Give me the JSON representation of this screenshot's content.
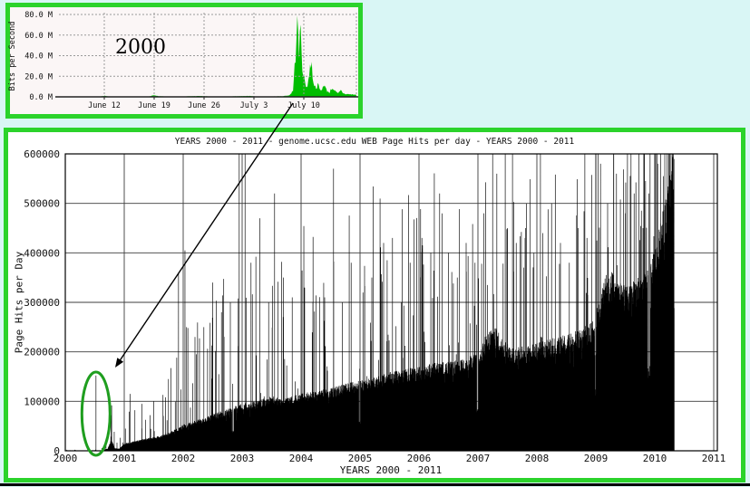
{
  "page": {
    "bg_color": "#d9f6f5",
    "accent_border_color": "#2bd32b",
    "bottom_rule_color": "#000000"
  },
  "annotations": {
    "arrow": "black arrow drawn from the inset 2000 bandwidth chart down to the circled first-traffic spike on the main chart",
    "ellipse_note": "green ellipse circling the isolated mid-2000 spike"
  },
  "chart_data": [
    {
      "id": "inset-bandwidth-week-2000",
      "type": "area",
      "annotation": "2000",
      "ylabel": "Bits per Second",
      "ylim": [
        0,
        80000000
      ],
      "yticks": [
        {
          "label": "80.0 M",
          "value": 80
        },
        {
          "label": "60.0 M",
          "value": 60
        },
        {
          "label": "40.0 M",
          "value": 40
        },
        {
          "label": "20.0 M",
          "value": 20
        },
        {
          "label": "0.0 M",
          "value": 0
        }
      ],
      "xticks": [
        "June 12",
        "June 19",
        "June 26",
        "July 3",
        "July 10"
      ],
      "legend_position": "none",
      "grid": true,
      "series": [
        {
          "name": "bits-per-second",
          "color": "#00bd00",
          "unit": "Mbit/s",
          "peak_mbps": 77,
          "secondary_peak_mbps": 65,
          "envelope_points_day_mbps": [
            [
              -2.4,
              0.15
            ],
            [
              2,
              0.2
            ],
            [
              3.4,
              0.25
            ],
            [
              4,
              1.1
            ],
            [
              4.6,
              0.3
            ],
            [
              8,
              0.2
            ],
            [
              10.4,
              0.4
            ],
            [
              11,
              1.7
            ],
            [
              11.6,
              0.5
            ],
            [
              14,
              0.2
            ],
            [
              17.5,
              0.8
            ],
            [
              18,
              0.5
            ],
            [
              21,
              0.2
            ],
            [
              24.5,
              0.9
            ],
            [
              25,
              0.3
            ],
            [
              27,
              0.25
            ],
            [
              29,
              0.6
            ],
            [
              30,
              1.5
            ],
            [
              30.5,
              6
            ],
            [
              30.8,
              35
            ],
            [
              31.05,
              77
            ],
            [
              31.3,
              38
            ],
            [
              31.55,
              65
            ],
            [
              31.8,
              30
            ],
            [
              32.1,
              14
            ],
            [
              32.4,
              9
            ],
            [
              32.7,
              18
            ],
            [
              33.05,
              35
            ],
            [
              33.3,
              16
            ],
            [
              33.6,
              9
            ],
            [
              34,
              11
            ],
            [
              34.4,
              5
            ],
            [
              34.8,
              12
            ],
            [
              35.2,
              6
            ],
            [
              35.6,
              4
            ],
            [
              36,
              9
            ],
            [
              36.4,
              5
            ],
            [
              36.8,
              3
            ],
            [
              37.2,
              6
            ],
            [
              37.6,
              3
            ],
            [
              38.2,
              2.5
            ],
            [
              39.4,
              2
            ]
          ]
        }
      ]
    },
    {
      "id": "main-page-hits-2000-2011",
      "type": "bar",
      "title": "YEARS 2000 - 2011 - genome.ucsc.edu WEB Page Hits per day - YEARS 2000 - 2011",
      "xlabel": "YEARS 2000 - 2011",
      "ylabel": "Page Hits per Day",
      "xlim": [
        2000,
        2011
      ],
      "ylim": [
        0,
        600000
      ],
      "grid": true,
      "bar_color": "#000000",
      "data_end_year": 2010.33,
      "yticks": [
        {
          "label": "600000",
          "value": 600000
        },
        {
          "label": "500000",
          "value": 500000
        },
        {
          "label": "400000",
          "value": 400000
        },
        {
          "label": "300000",
          "value": 300000
        },
        {
          "label": "200000",
          "value": 200000
        },
        {
          "label": "100000",
          "value": 100000
        },
        {
          "label": "0",
          "value": 0
        }
      ],
      "xticks": [
        "2000",
        "2001",
        "2002",
        "2003",
        "2004",
        "2005",
        "2006",
        "2007",
        "2008",
        "2009",
        "2010",
        "2011"
      ],
      "baseline_points_year_hits": [
        [
          2000.0,
          400
        ],
        [
          2000.45,
          400
        ],
        [
          2000.5,
          500
        ],
        [
          2000.6,
          600
        ],
        [
          2000.72,
          4000
        ],
        [
          2000.78,
          22000
        ],
        [
          2000.84,
          5000
        ],
        [
          2000.92,
          4000
        ],
        [
          2001.0,
          14000
        ],
        [
          2001.15,
          18000
        ],
        [
          2001.3,
          22000
        ],
        [
          2001.5,
          26000
        ],
        [
          2001.7,
          32000
        ],
        [
          2001.85,
          40000
        ],
        [
          2002.0,
          50000
        ],
        [
          2002.2,
          58000
        ],
        [
          2002.4,
          65000
        ],
        [
          2002.6,
          74000
        ],
        [
          2002.8,
          82000
        ],
        [
          2003.0,
          90000
        ],
        [
          2003.25,
          96000
        ],
        [
          2003.5,
          104000
        ],
        [
          2003.75,
          100000
        ],
        [
          2004.0,
          110000
        ],
        [
          2004.25,
          114000
        ],
        [
          2004.5,
          120000
        ],
        [
          2004.75,
          128000
        ],
        [
          2005.0,
          134000
        ],
        [
          2005.25,
          140000
        ],
        [
          2005.5,
          150000
        ],
        [
          2005.75,
          156000
        ],
        [
          2006.0,
          160000
        ],
        [
          2006.25,
          168000
        ],
        [
          2006.5,
          170000
        ],
        [
          2006.75,
          176000
        ],
        [
          2007.0,
          186000
        ],
        [
          2007.15,
          225000
        ],
        [
          2007.3,
          235000
        ],
        [
          2007.45,
          210000
        ],
        [
          2007.6,
          196000
        ],
        [
          2007.8,
          200000
        ],
        [
          2008.0,
          206000
        ],
        [
          2008.25,
          214000
        ],
        [
          2008.5,
          222000
        ],
        [
          2008.75,
          232000
        ],
        [
          2008.95,
          248000
        ],
        [
          2009.05,
          290000
        ],
        [
          2009.15,
          335000
        ],
        [
          2009.3,
          345000
        ],
        [
          2009.45,
          315000
        ],
        [
          2009.6,
          320000
        ],
        [
          2009.75,
          335000
        ],
        [
          2009.9,
          355000
        ],
        [
          2010.0,
          395000
        ],
        [
          2010.08,
          430000
        ],
        [
          2010.16,
          470000
        ],
        [
          2010.24,
          520000
        ],
        [
          2010.3,
          565000
        ],
        [
          2010.33,
          585000
        ]
      ],
      "notable_spikes_year_hits": [
        [
          2000.52,
          152000
        ],
        [
          2001.1,
          115000
        ],
        [
          2001.3,
          95000
        ],
        [
          2001.5,
          100000
        ],
        [
          2001.75,
          145000
        ],
        [
          2001.92,
          360000
        ],
        [
          2002.03,
          405000
        ],
        [
          2002.2,
          230000
        ],
        [
          2002.35,
          250000
        ],
        [
          2002.5,
          340000
        ],
        [
          2002.65,
          280000
        ],
        [
          2002.8,
          300000
        ],
        [
          2002.95,
          600000
        ],
        [
          2003.05,
          600000
        ],
        [
          2003.15,
          380000
        ],
        [
          2003.3,
          470000
        ],
        [
          2003.45,
          300000
        ],
        [
          2003.55,
          520000
        ],
        [
          2003.7,
          350000
        ],
        [
          2003.85,
          310000
        ],
        [
          2004.05,
          330000
        ],
        [
          2004.2,
          300000
        ],
        [
          2004.4,
          310000
        ],
        [
          2004.55,
          570000
        ],
        [
          2004.7,
          300000
        ],
        [
          2004.85,
          380000
        ],
        [
          2005.05,
          320000
        ],
        [
          2005.2,
          350000
        ],
        [
          2005.4,
          420000
        ],
        [
          2005.55,
          430000
        ],
        [
          2005.7,
          300000
        ],
        [
          2005.85,
          380000
        ],
        [
          2006.05,
          430000
        ],
        [
          2006.2,
          400000
        ],
        [
          2006.35,
          520000
        ],
        [
          2006.5,
          400000
        ],
        [
          2006.65,
          350000
        ],
        [
          2006.8,
          420000
        ],
        [
          2006.95,
          380000
        ],
        [
          2007.1,
          480000
        ],
        [
          2007.25,
          600000
        ],
        [
          2007.32,
          560000
        ],
        [
          2007.5,
          450000
        ],
        [
          2007.65,
          420000
        ],
        [
          2007.8,
          430000
        ],
        [
          2007.95,
          400000
        ],
        [
          2008.1,
          440000
        ],
        [
          2008.25,
          500000
        ],
        [
          2008.4,
          420000
        ],
        [
          2008.55,
          380000
        ],
        [
          2008.7,
          450000
        ],
        [
          2008.85,
          430000
        ],
        [
          2009.0,
          600000
        ],
        [
          2009.08,
          580000
        ],
        [
          2009.2,
          500000
        ],
        [
          2009.35,
          560000
        ],
        [
          2009.5,
          480000
        ],
        [
          2009.65,
          520000
        ],
        [
          2009.8,
          450000
        ],
        [
          2009.9,
          520000
        ],
        [
          2010.0,
          600000
        ],
        [
          2010.05,
          580000
        ],
        [
          2010.1,
          600000
        ],
        [
          2010.17,
          600000
        ],
        [
          2010.24,
          600000
        ],
        [
          2010.3,
          600000
        ]
      ],
      "dip_ranges_year": [
        [
          2002.83,
          2002.86
        ],
        [
          2004.98,
          2005.01
        ],
        [
          2006.98,
          2007.01
        ],
        [
          2008.98,
          2009.01
        ],
        [
          2009.88,
          2009.92
        ]
      ],
      "highlight_ellipse": {
        "center_year": 2000.52,
        "value_hits": 152000,
        "color": "#1f9e1f"
      }
    }
  ]
}
